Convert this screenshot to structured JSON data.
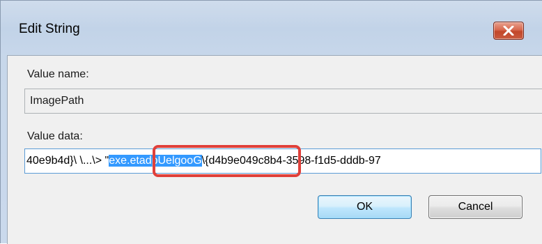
{
  "dialog": {
    "title": "Edit String",
    "close_icon": "close-x-icon",
    "accent_close": "#c94a2e"
  },
  "value_name": {
    "label": "Value name:",
    "value": "ImagePath"
  },
  "value_data": {
    "label": "Value data:",
    "text_before": "40e9b4d}\\  \\...\\> \"",
    "text_selected": "exe.etadpUelgooG",
    "text_after": "\\{d4b9e049c8b4-3598-f1d5-dddb-97",
    "selection_color": "#3399ff",
    "highlight_color": "#e0403a"
  },
  "buttons": {
    "ok": "OK",
    "cancel": "Cancel"
  }
}
